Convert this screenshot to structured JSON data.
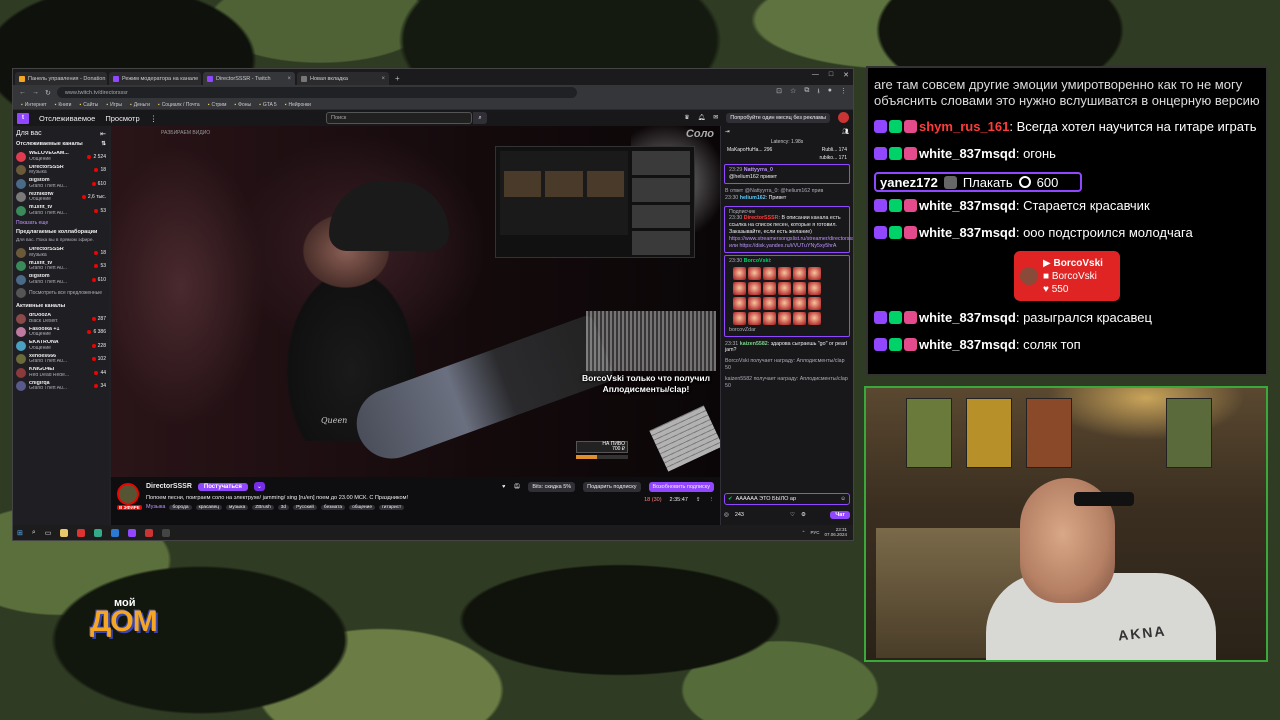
{
  "browser": {
    "tabs": [
      {
        "label": "Панель управления - Donation"
      },
      {
        "label": "Режим модератора на канале"
      },
      {
        "label": "DirectorSSSR - Twitch"
      },
      {
        "label": "Новая вкладка"
      }
    ],
    "new_tab": "+",
    "url": "www.twitch.tv/directorsssr",
    "bookmarks": [
      "Интернет",
      "Книги",
      "Сайты",
      "Игры",
      "Деньги",
      "Социалк / Почта",
      "Стрим",
      "Фоны",
      "GTA 5",
      "Нейронки"
    ]
  },
  "twitch_header": {
    "following": "Отслеживаемое",
    "browse": "Просмотр",
    "search_placeholder": "Поиск",
    "promo": "Попробуйте один месяц без рекламы"
  },
  "sidebar": {
    "title": "Для вас",
    "followed_title": "Отслеживаемые каналы",
    "followed": [
      {
        "name": "WELOVEGAM...",
        "category": "Общение",
        "viewers": "2 524",
        "color": "#e03c50"
      },
      {
        "name": "DirectorSSSR",
        "category": "Музыка",
        "viewers": "18",
        "color": "#6b5a3a"
      },
      {
        "name": "bigstom",
        "category": "Grand Theft Au...",
        "viewers": "610",
        "color": "#4a6a8a"
      },
      {
        "name": "reznikbfw",
        "category": "Общение",
        "viewers": "2,6 тыс.",
        "color": "#7a7a7a"
      },
      {
        "name": "m1sfit_tv",
        "category": "Grand Theft Au...",
        "viewers": "53",
        "color": "#3a8a5a"
      }
    ],
    "show_more": "Показать еще",
    "suggested_title": "Предлагаемые коллаборации",
    "suggested_note": "Для вас. Пока вы в прямом эфире.",
    "suggested": [
      {
        "name": "DirectorSSSR",
        "category": "Музыка",
        "viewers": "18",
        "color": "#6b5a3a"
      },
      {
        "name": "m1sfit_tv",
        "category": "Grand Theft Au...",
        "viewers": "53",
        "color": "#3a8a5a"
      },
      {
        "name": "bigstom",
        "category": "Grand Theft Au...",
        "viewers": "610",
        "color": "#4a6a8a"
      }
    ],
    "see_all": "Посмотреть все предложенные",
    "active_title": "Активные каналы",
    "active": [
      {
        "name": "drDoozA",
        "category": "Black Desert",
        "viewers": "287",
        "color": "#8a4a4a"
      },
      {
        "name": "Fasoolka +1",
        "category": "Общение",
        "viewers": "6 386",
        "color": "#c07aa0"
      },
      {
        "name": "EKATRONA",
        "category": "Общение",
        "viewers": "228",
        "color": "#4aa0c0"
      },
      {
        "name": "xenoes666",
        "category": "Grand Theft Au...",
        "viewers": "102",
        "color": "#6a6a3a"
      },
      {
        "name": "KNIGO4Ei",
        "category": "Red Dead Rede...",
        "viewers": "44",
        "color": "#8a3a3a"
      },
      {
        "name": "chiglrqa",
        "category": "Grand Theft Au...",
        "viewers": "34",
        "color": "#5a5a8a"
      }
    ]
  },
  "video": {
    "overlay_text": "Соло",
    "watermark": "РАЗБИРАЕМ ВИДИО",
    "alert": "BorcoVski только что получил Аплодисменты/clap!",
    "tee_text": "Queen",
    "donate_label": "НА ПИВО",
    "donate_amount": "700 ₽",
    "donate_progress": 0.4
  },
  "stream_info": {
    "channel": "DirectorSSSR",
    "live": "В ЭФИРЕ",
    "follow": "Постучаться",
    "bits": "Bits: скидка 5%",
    "gift": "Подарить подписку",
    "resub": "Возобновить подписку",
    "title": "Попоем песни, поиграем соло на электрухе/ jamming/ sing [ru/en] поем до 23.00 МСК. С Праздником!",
    "category": "Музыка",
    "tags": [
      "борода",
      "красавец",
      "музыка",
      "ZBrush",
      "3d",
      "Русский",
      "безмата",
      "общение",
      "гитарист"
    ],
    "viewers": "18 (30)",
    "uptime": "2:35:47"
  },
  "chat": {
    "latency": "Latency: 1.98s",
    "hype": [
      {
        "name": "MaKapoHuHa...",
        "value": "296"
      },
      {
        "name": "Rubli...",
        "value": "174"
      },
      {
        "name": "rubiko...",
        "value": "171"
      }
    ],
    "messages": [
      {
        "time": "23:29",
        "user": "Nattyyrra_0",
        "text": "@helium162 привет"
      },
      {
        "time": "",
        "user": "",
        "text": "В ответ @Nattyyrra_0: @helium162 прив"
      },
      {
        "time": "23:30",
        "user": "helium162",
        "text": "Привет"
      },
      {
        "time": "",
        "user": "",
        "text": "Подписчик"
      },
      {
        "time": "23:30",
        "user": "DirectorSSSR",
        "text": "В описании канала есть ссылка на список песен, которые я готовил. Заказывайте, если есть желание)"
      },
      {
        "time": "",
        "user": "",
        "text": "https://www.streamersongslist.ru/streamer/directorsssr/songs или https://disk.yandex.ru/i/VUTuYNy5xy5hrA"
      },
      {
        "time": "23:30",
        "user": "BorcoVski",
        "text": ""
      },
      {
        "time": "",
        "user": "",
        "text": "borcovZdar"
      },
      {
        "time": "23:31",
        "user": "kaizen5582",
        "text": "здарова сыграешь \"go\" or pearl jam?"
      },
      {
        "time": "",
        "user": "",
        "text": "BorcoVski получает награду: Аплодисменты/clap 50"
      },
      {
        "time": "",
        "user": "",
        "text": "kaizen5582 получает награду: Аплодисменты/clap 50"
      }
    ],
    "input_value": "АААААА ЭТО БЫЛО ар",
    "points": "243",
    "chat_button": "Чат"
  },
  "taskbar": {
    "time": "23:31",
    "date": "07.06.2024",
    "lang": "РУС"
  },
  "overlay_chat": {
    "top_text": "are там совсем другие эмоции умиротворенно как то не могу объяснить словами это нужно вслушиватся в онцерную версию",
    "lines": [
      {
        "user": "shym_rus_161",
        "user_color": "#ff3b3b",
        "text": "Всегда хотел научится на гитаре играть"
      },
      {
        "user": "white_837msqd",
        "user_color": "#ffffff",
        "text": "огонь"
      }
    ],
    "redeem": {
      "user": "yanez172",
      "reward": "Плакать",
      "cost": "600"
    },
    "lines2": [
      {
        "user": "white_837msqd",
        "user_color": "#ffffff",
        "text": "Старается красавчик"
      },
      {
        "user": "white_837msqd",
        "user_color": "#ffffff",
        "text": "ооо подстроился молодчага"
      }
    ],
    "yt_card": {
      "name": "BorcoVski",
      "sub": "BorcoVski",
      "likes": "550"
    },
    "lines3": [
      {
        "user": "white_837msqd",
        "user_color": "#ffffff",
        "text": "разыгрался красавец"
      },
      {
        "user": "white_837msqd",
        "user_color": "#ffffff",
        "text": "соляк топ"
      }
    ]
  },
  "logo": {
    "small": "мой",
    "big": "ДОМ"
  },
  "webcam": {
    "shirt_text": "AKNA"
  }
}
